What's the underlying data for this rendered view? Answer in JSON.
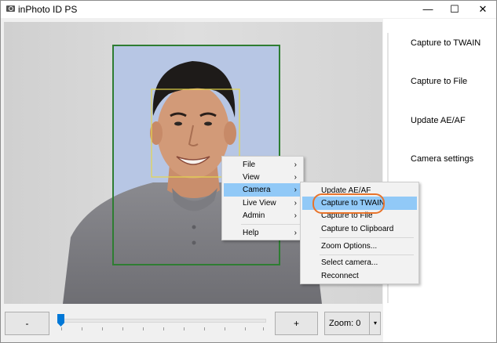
{
  "window": {
    "title": "inPhoto ID PS",
    "controls": [
      "—",
      "☐",
      "✕"
    ]
  },
  "right_panel": {
    "links": [
      "Capture to TWAIN",
      "Capture to File",
      "Update AE/AF",
      "Camera settings"
    ]
  },
  "toolbar": {
    "minus_label": "-",
    "plus_label": "+",
    "zoom_label": "Zoom: 0",
    "zoom_arrow": "▾"
  },
  "context_menu": {
    "items": [
      {
        "label": "File",
        "arrow": "›"
      },
      {
        "label": "View",
        "arrow": "›"
      },
      {
        "label": "Camera",
        "arrow": "›"
      },
      {
        "label": "Live View",
        "arrow": "›"
      },
      {
        "label": "Admin",
        "arrow": "›"
      },
      {
        "label": "Help",
        "arrow": "›"
      }
    ]
  },
  "camera_submenu": {
    "items": [
      "Update AE/AF",
      "Capture to TWAIN",
      "Capture to File",
      "Capture to Clipboard",
      "Zoom Options...",
      "Select camera...",
      "Reconnect"
    ]
  },
  "colors": {
    "crop_frame": "#2e7d32",
    "face_frame": "#e6d84a",
    "menu_highlight": "#91c9f7",
    "annotation_ring": "#e8732a",
    "slider_thumb": "#0078d7"
  }
}
